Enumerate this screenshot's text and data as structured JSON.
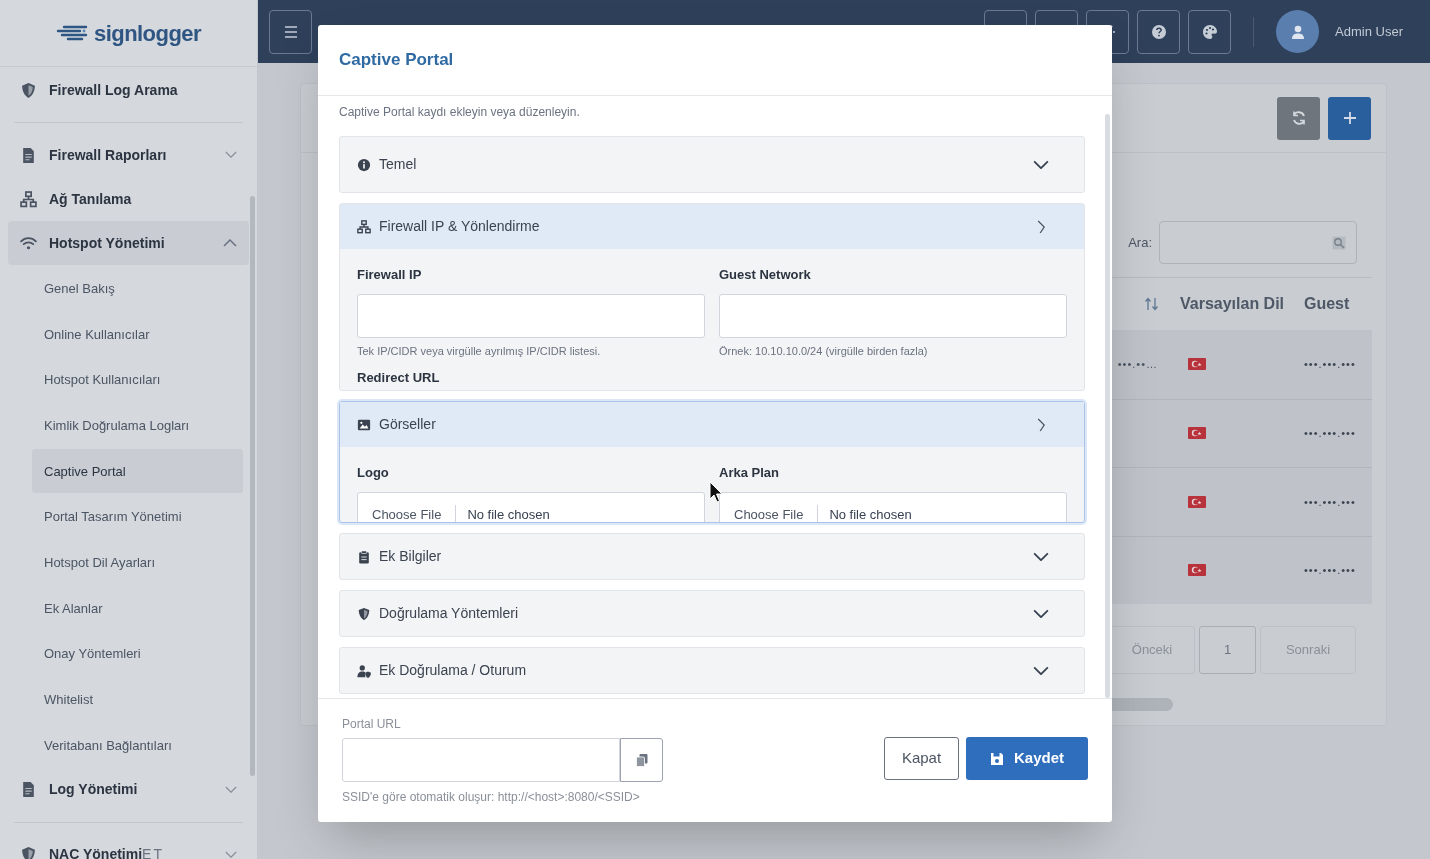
{
  "sidebar": {
    "logo": "signlogger",
    "items": [
      {
        "label": "Firewall Log Arama",
        "expandable": false,
        "expanded": false
      },
      {
        "label": "Firewall Raporları",
        "expandable": true,
        "expanded": false
      },
      {
        "label": "Ağ Tanılama",
        "expandable": false,
        "expanded": false
      },
      {
        "label": "Hotspot Yönetimi",
        "expandable": true,
        "expanded": true,
        "children": [
          {
            "label": "Genel Bakış",
            "selected": false
          },
          {
            "label": "Online Kullanıcılar",
            "selected": false
          },
          {
            "label": "Hotspot Kullanıcıları",
            "selected": false
          },
          {
            "label": "Kimlik Doğrulama Logları",
            "selected": false
          },
          {
            "label": "Captive Portal",
            "selected": true
          },
          {
            "label": "Portal Tasarım Yönetimi",
            "selected": false
          },
          {
            "label": "Hotspot Dil Ayarları",
            "selected": false
          },
          {
            "label": "Ek Alanlar",
            "selected": false
          },
          {
            "label": "Onay Yöntemleri",
            "selected": false
          },
          {
            "label": "Whitelist",
            "selected": false
          },
          {
            "label": "Veritabanı Bağlantıları",
            "selected": false
          }
        ]
      },
      {
        "label": "Log Yönetimi",
        "expandable": true,
        "expanded": false
      },
      {
        "label": "NAC Yönetimi",
        "expandable": true,
        "expanded": false,
        "overlap_text": "ET"
      }
    ]
  },
  "header": {
    "user": "Admin User"
  },
  "background": {
    "search_label": "Ara:",
    "columns": [
      "Varsayılan Dil",
      "Guest"
    ],
    "rows": [
      {
        "column_1": "•••.••…",
        "guest": "•••.•••.•••"
      },
      {
        "guest": "•••.•••.•••"
      },
      {
        "guest": "•••.•••.•••"
      },
      {
        "guest": "•••.•••.•••"
      }
    ],
    "pagination": {
      "prev": "Önceki",
      "pages": [
        {
          "label": "1",
          "selected": true
        }
      ],
      "next": "Sonraki"
    }
  },
  "modal": {
    "title": "Captive Portal",
    "description": "Captive Portal kaydı ekleyin veya düzenleyin.",
    "sections": [
      {
        "title": "Temel",
        "expanded": false,
        "focused": false
      },
      {
        "title": "Firewall IP & Yönlendirme",
        "expanded": true,
        "focused": false,
        "fields": [
          {
            "label": "Firewall IP",
            "kind": "text",
            "help": "Tek IP/CIDR veya virgülle ayrılmış IP/CIDR listesi."
          },
          {
            "label": "Guest Network",
            "kind": "text",
            "help": "Örnek: 10.10.10.0/24 (virgülle birden fazla)"
          },
          {
            "label": "Redirect URL",
            "kind": "label"
          }
        ]
      },
      {
        "title": "Görseller",
        "expanded": true,
        "focused": true,
        "fields": [
          {
            "label": "Logo",
            "kind": "file",
            "button": "Choose File",
            "value": "No file chosen"
          },
          {
            "label": "Arka Plan",
            "kind": "file",
            "button": "Choose File",
            "value": "No file chosen"
          }
        ]
      },
      {
        "title": "Ek Bilgiler",
        "expanded": false,
        "focused": false
      },
      {
        "title": "Doğrulama Yöntemleri",
        "expanded": false,
        "focused": false
      },
      {
        "title": "Ek Doğrulama / Oturum",
        "expanded": false,
        "focused": false
      }
    ],
    "portal_url": {
      "label": "Portal URL",
      "hint": "SSID'e göre otomatik oluşur: http://<host>:8080/<SSID>"
    },
    "buttons": [
      {
        "label": "Kapat",
        "kind": "secondary"
      },
      {
        "label": "Kaydet",
        "kind": "primary"
      }
    ]
  }
}
